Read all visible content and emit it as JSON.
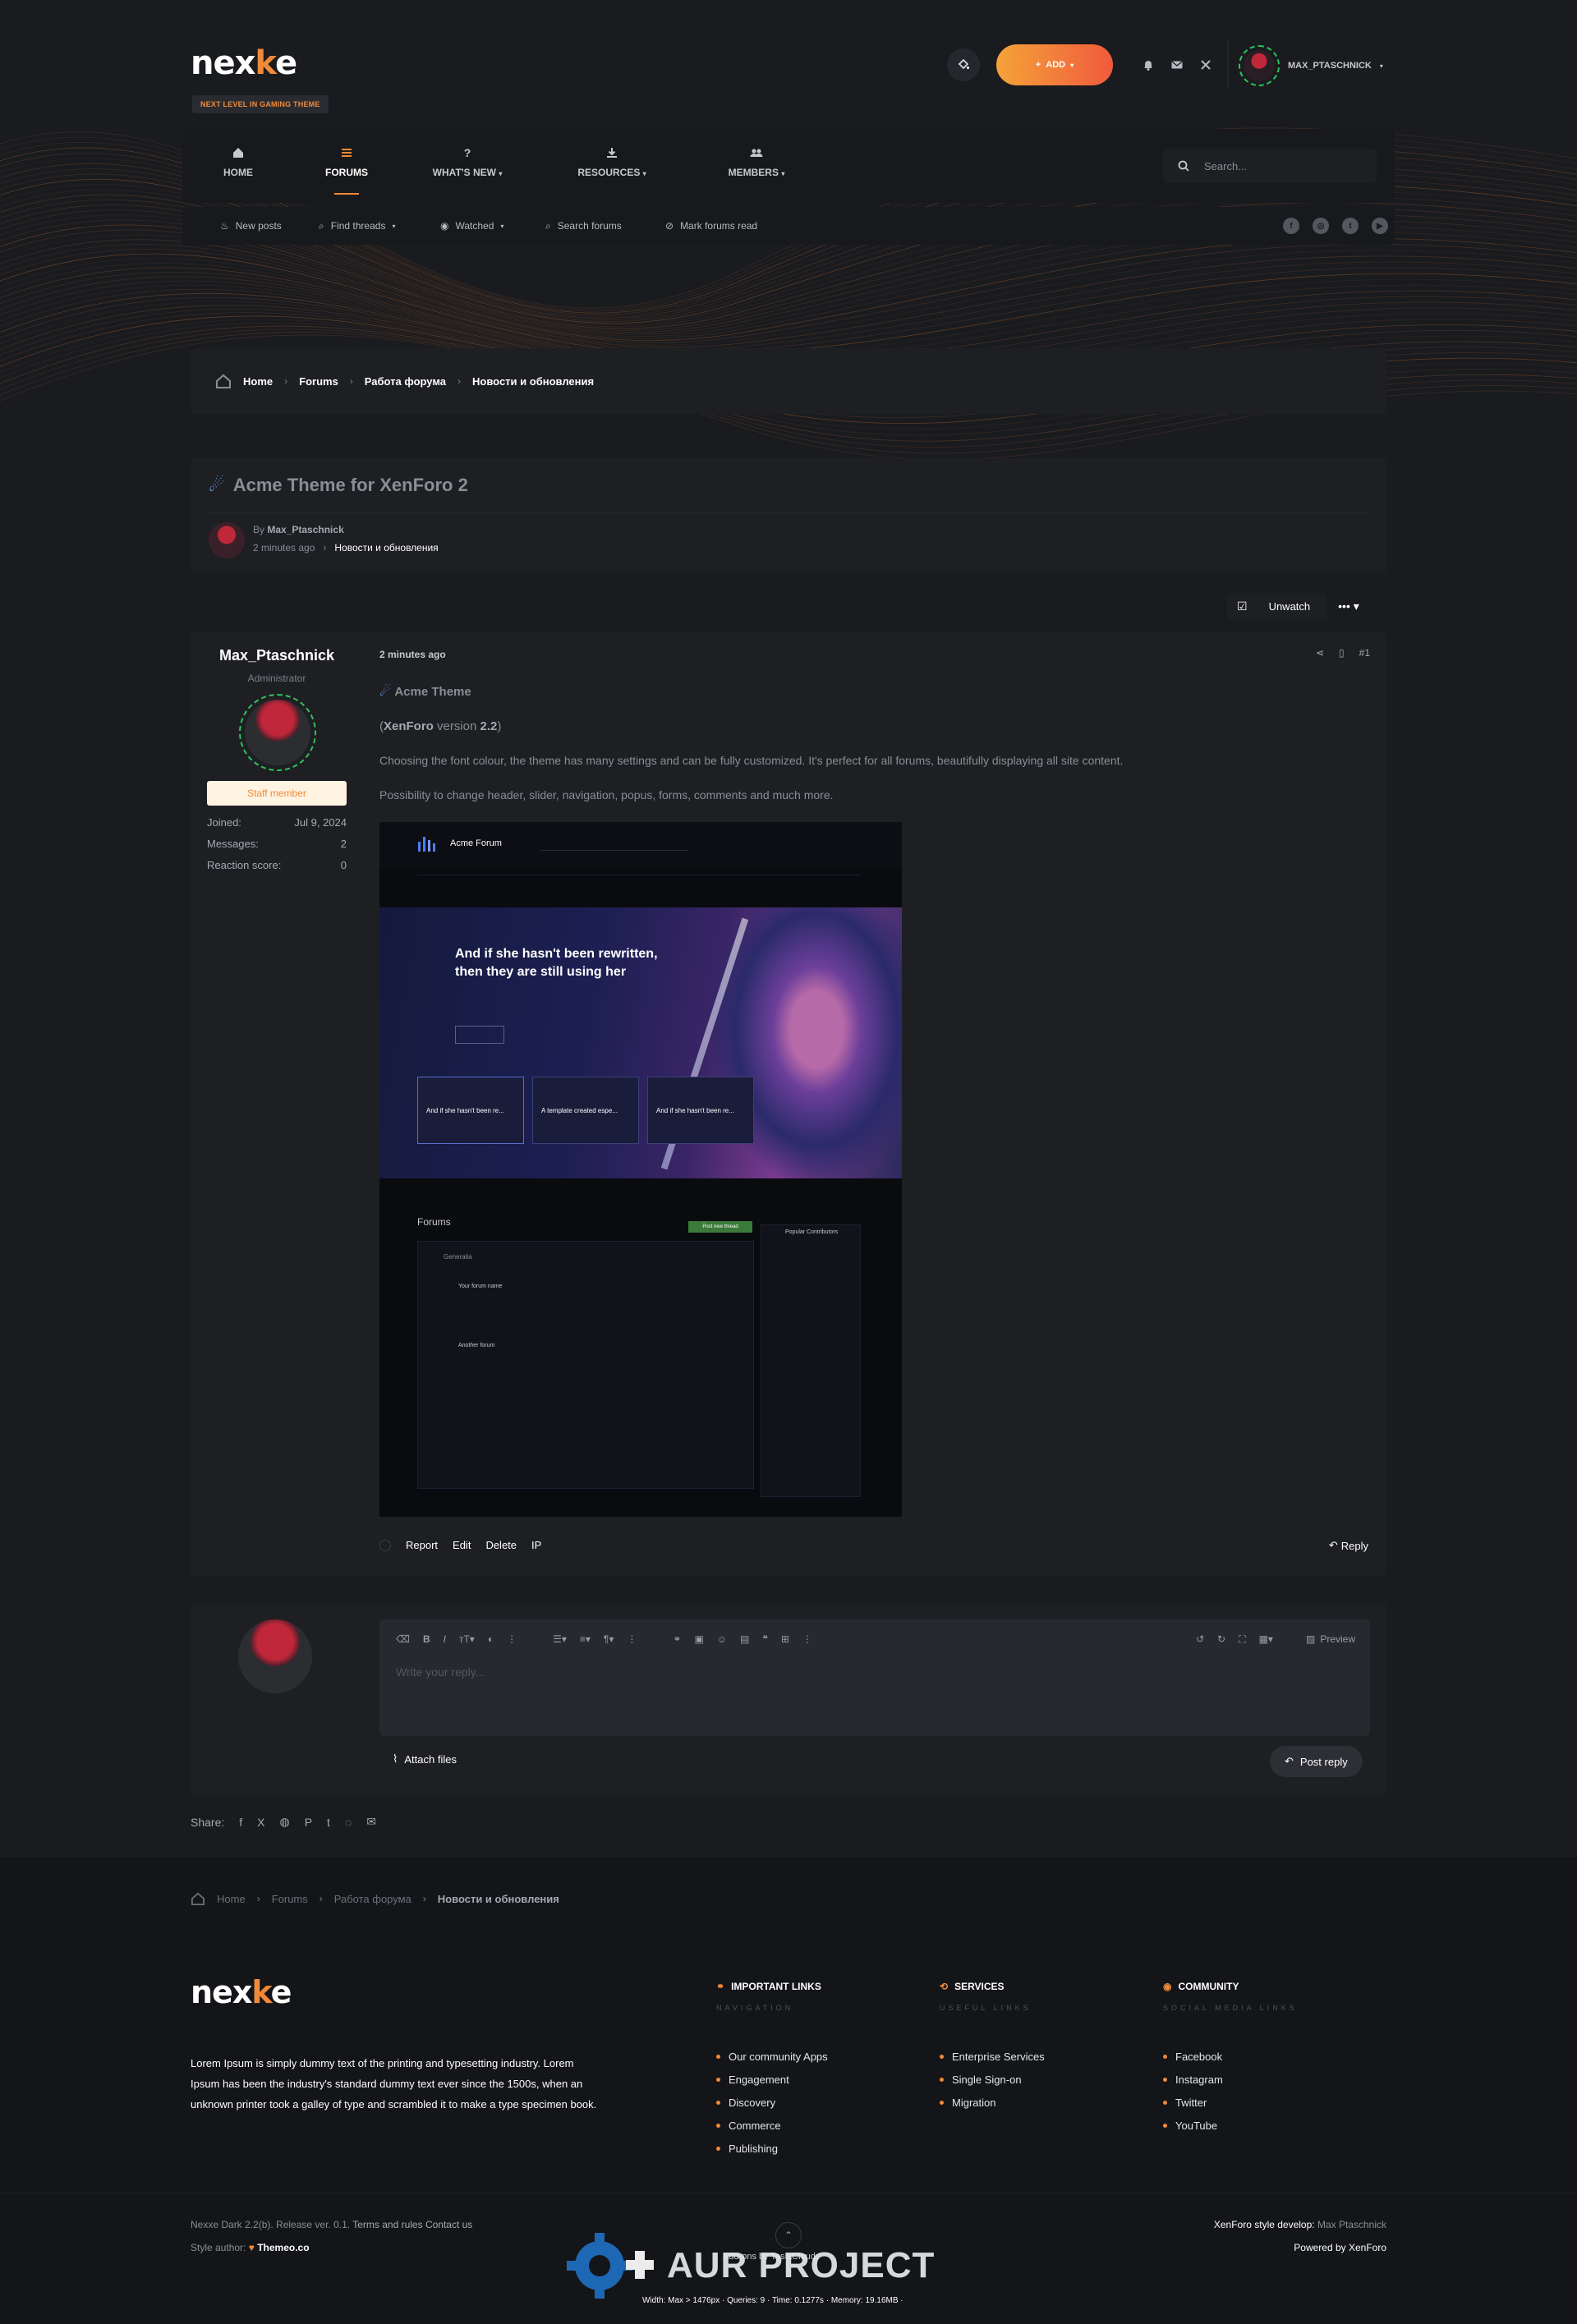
{
  "header": {
    "logo_pre": "nex",
    "logo_mid": "k",
    "logo_post": "e",
    "tagline": "NEXT LEVEL IN GAMING THEME",
    "add_label": "ADD",
    "username": "MAX_PTASCHNICK"
  },
  "nav": {
    "items": [
      {
        "label": "HOME",
        "icon": "home-icon"
      },
      {
        "label": "FORUMS",
        "icon": "list-icon"
      },
      {
        "label": "WHAT'S NEW",
        "icon": "question-icon"
      },
      {
        "label": "RESOURCES",
        "icon": "download-icon"
      },
      {
        "label": "MEMBERS",
        "icon": "users-icon"
      }
    ],
    "search_placeholder": "Search..."
  },
  "subnav": {
    "items": [
      "New posts",
      "Find threads",
      "Watched",
      "Search forums",
      "Mark forums read"
    ]
  },
  "breadcrumb": [
    "Home",
    "Forums",
    "Работа форума",
    "Новости и обновления"
  ],
  "thread": {
    "title": "Acme Theme for XenForo 2",
    "by_label": "By",
    "author": "Max_Ptaschnick",
    "time": "2 minutes ago",
    "forum": "Новости и обновления",
    "unwatch": "Unwatch"
  },
  "post": {
    "username": "Max_Ptaschnick",
    "role": "Administrator",
    "staff": "Staff member",
    "stats": [
      {
        "label": "Joined:",
        "value": "Jul 9, 2024"
      },
      {
        "label": "Messages:",
        "value": "2"
      },
      {
        "label": "Reaction score:",
        "value": "0"
      }
    ],
    "time": "2 minutes ago",
    "number": "#1",
    "heading": "Acme Theme",
    "version_pre": "(",
    "version_brand": "XenForo",
    "version_mid": " version ",
    "version_num": "2.2",
    "version_post": ")",
    "para1": "Choosing the font colour, the theme has many settings and can be fully customized. It's perfect for all forums, beautifully displaying all site content.",
    "para2": "Possibility to change header, slider, navigation, popus, forms, comments and much more.",
    "actions": [
      "Report",
      "Edit",
      "Delete",
      "IP"
    ],
    "reply": "Reply"
  },
  "screenshot": {
    "site_name": "Acme Forum",
    "hero_title_1": "And if she hasn't been rewritten,",
    "hero_title_2": "then they are still using her",
    "cards": [
      "And if she hasn't been re...",
      "A template created espe...",
      "And if she hasn't been re..."
    ],
    "forums_title": "Forums",
    "new_thread": "Post new thread",
    "category": "Generalia",
    "forum1": "Your forum name",
    "forum2": "Another forum",
    "sidebar_title": "Popular Contributors"
  },
  "editor": {
    "placeholder": "Write your reply...",
    "preview": "Preview",
    "attach": "Attach files",
    "post_reply": "Post reply"
  },
  "share": {
    "label": "Share:"
  },
  "footer": {
    "breadcrumb": [
      "Home",
      "Forums",
      "Работа форума",
      "Новости и обновления"
    ],
    "about": "Lorem Ipsum is simply dummy text of the printing and typesetting industry. Lorem Ipsum has been the industry's standard dummy text ever since the 1500s, when an unknown printer took a galley of type and scrambled it to make a type specimen book.",
    "cols": [
      {
        "title": "IMPORTANT LINKS",
        "sub": "NAVIGATION",
        "links": [
          "Our community Apps",
          "Engagement",
          "Discovery",
          "Commerce",
          "Publishing"
        ]
      },
      {
        "title": "SERVICES",
        "sub": "USEFUL LINKS",
        "links": [
          "Enterprise Services",
          "Single Sign-on",
          "Migration"
        ]
      },
      {
        "title": "COMMUNITY",
        "sub": "SOCIAL MEDIA LINKS",
        "links": [
          "Facebook",
          "Instagram",
          "Twitter",
          "YouTube"
        ]
      }
    ],
    "release": "Nexxe Dark 2.2(b). Release ver. 0.1.",
    "terms": "Terms and rules",
    "contact": "Contact us",
    "style_author_label": "Style author:",
    "style_author": "Themeo.co",
    "addons": "Add-ons by TeslaCloud",
    "debug": "Width: Max > 1476px · Queries: 9 · Time: 0.1277s · Memory: 19.16MB ·",
    "develop_label": "XenForo style develop:",
    "develop_name": "Max Ptaschnick",
    "powered": "Powered by XenForo",
    "watermark": "AUR PROJECT"
  },
  "colors": {
    "accent": "#f08a3a",
    "background": "#1a1b1f",
    "panel": "#1e1f23",
    "online": "#2ec35d"
  }
}
